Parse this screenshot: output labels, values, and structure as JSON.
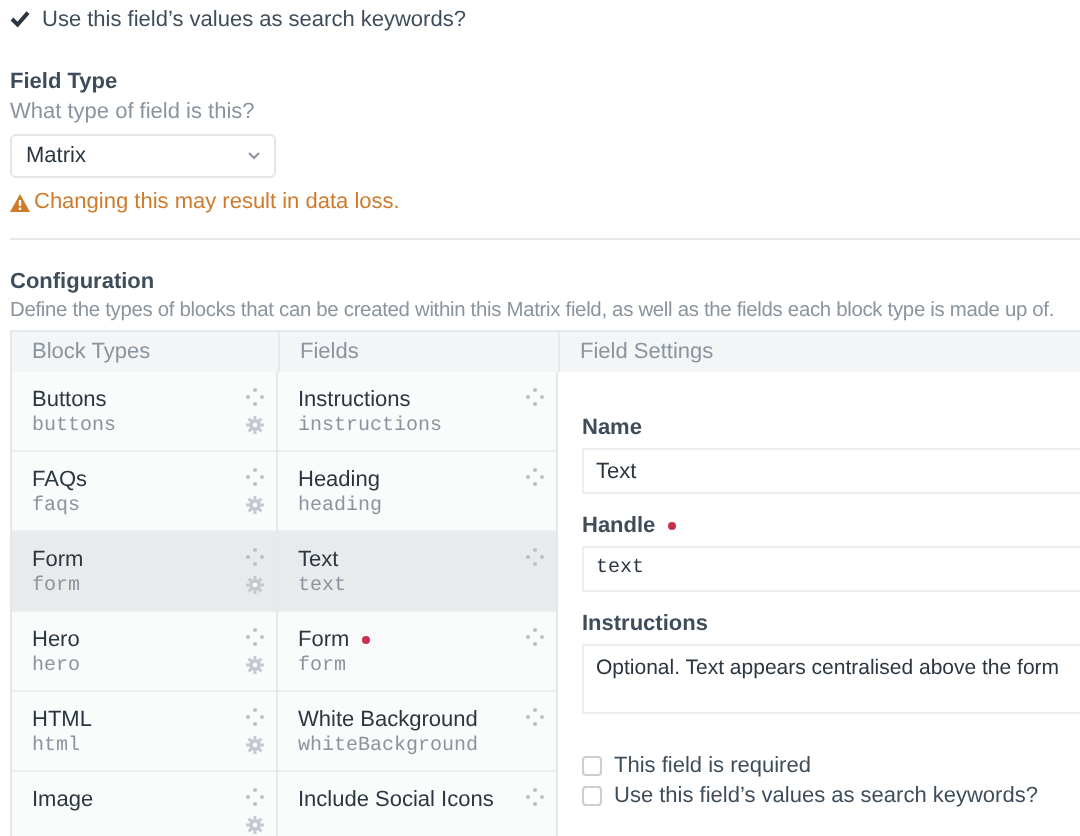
{
  "search_keywords_option": {
    "label": "Use this field’s values as search keywords?",
    "checked": true
  },
  "field_type": {
    "label": "Field Type",
    "hint": "What type of field is this?",
    "value": "Matrix",
    "warning": "Changing this may result in data loss."
  },
  "configuration": {
    "label": "Configuration",
    "description": "Define the types of blocks that can be created within this Matrix field, as well as the fields each block type is made up of.",
    "columns": [
      "Block Types",
      "Fields",
      "Field Settings"
    ],
    "block_types": [
      {
        "name": "Buttons",
        "handle": "buttons",
        "selected": false
      },
      {
        "name": "FAQs",
        "handle": "faqs",
        "selected": false
      },
      {
        "name": "Form",
        "handle": "form",
        "selected": true
      },
      {
        "name": "Hero",
        "handle": "hero",
        "selected": false
      },
      {
        "name": "HTML",
        "handle": "html",
        "selected": false
      },
      {
        "name": "Image",
        "selected": false
      }
    ],
    "fields": [
      {
        "name": "Instructions",
        "handle": "instructions",
        "required": false,
        "selected": false
      },
      {
        "name": "Heading",
        "handle": "heading",
        "required": false,
        "selected": false
      },
      {
        "name": "Text",
        "handle": "text",
        "required": false,
        "selected": true
      },
      {
        "name": "Form",
        "handle": "form",
        "required": true,
        "selected": false
      },
      {
        "name": "White Background",
        "handle": "whiteBackground",
        "required": false,
        "selected": false
      },
      {
        "name": "Include Social Icons",
        "required": false,
        "selected": false
      }
    ],
    "field_settings": {
      "name_label": "Name",
      "name_value": "Text",
      "handle_label": "Handle",
      "handle_required": true,
      "handle_value": "text",
      "instructions_label": "Instructions",
      "instructions_value": "Optional. Text appears centralised above the form",
      "options": [
        {
          "label": "This field is required",
          "checked": false
        },
        {
          "label": "Use this field’s values as search keywords?",
          "checked": false
        }
      ]
    }
  }
}
